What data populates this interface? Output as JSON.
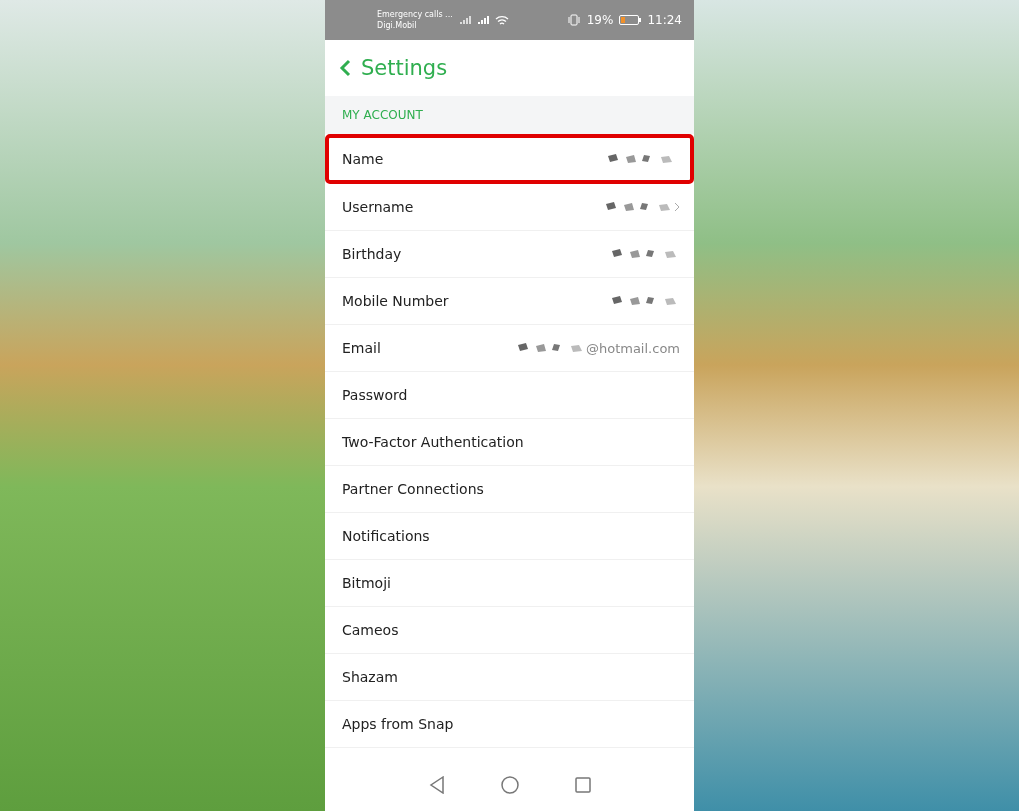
{
  "status_bar": {
    "carrier_line_1": "Emergency calls ...",
    "carrier_line_2": "Digi.Mobil",
    "battery_text": "19%",
    "time": "11:24"
  },
  "header": {
    "title": "Settings"
  },
  "section": {
    "title": "MY ACCOUNT"
  },
  "rows": [
    {
      "label": "Name",
      "redacted": true,
      "chevron": false,
      "highlighted": true
    },
    {
      "label": "Username",
      "redacted": true,
      "chevron": true,
      "highlighted": false
    },
    {
      "label": "Birthday",
      "redacted": true,
      "chevron": false,
      "highlighted": false
    },
    {
      "label": "Mobile Number",
      "redacted": true,
      "chevron": false,
      "highlighted": false
    },
    {
      "label": "Email",
      "redacted": true,
      "value": "@hotmail.com",
      "chevron": false,
      "highlighted": false
    },
    {
      "label": "Password",
      "redacted": false,
      "chevron": false,
      "highlighted": false
    },
    {
      "label": "Two-Factor Authentication",
      "redacted": false,
      "chevron": false,
      "highlighted": false
    },
    {
      "label": "Partner Connections",
      "redacted": false,
      "chevron": false,
      "highlighted": false
    },
    {
      "label": "Notifications",
      "redacted": false,
      "chevron": false,
      "highlighted": false
    },
    {
      "label": "Bitmoji",
      "redacted": false,
      "chevron": false,
      "highlighted": false
    },
    {
      "label": "Cameos",
      "redacted": false,
      "chevron": false,
      "highlighted": false
    },
    {
      "label": "Shazam",
      "redacted": false,
      "chevron": false,
      "highlighted": false
    },
    {
      "label": "Apps from Snap",
      "redacted": false,
      "chevron": false,
      "highlighted": false
    }
  ]
}
